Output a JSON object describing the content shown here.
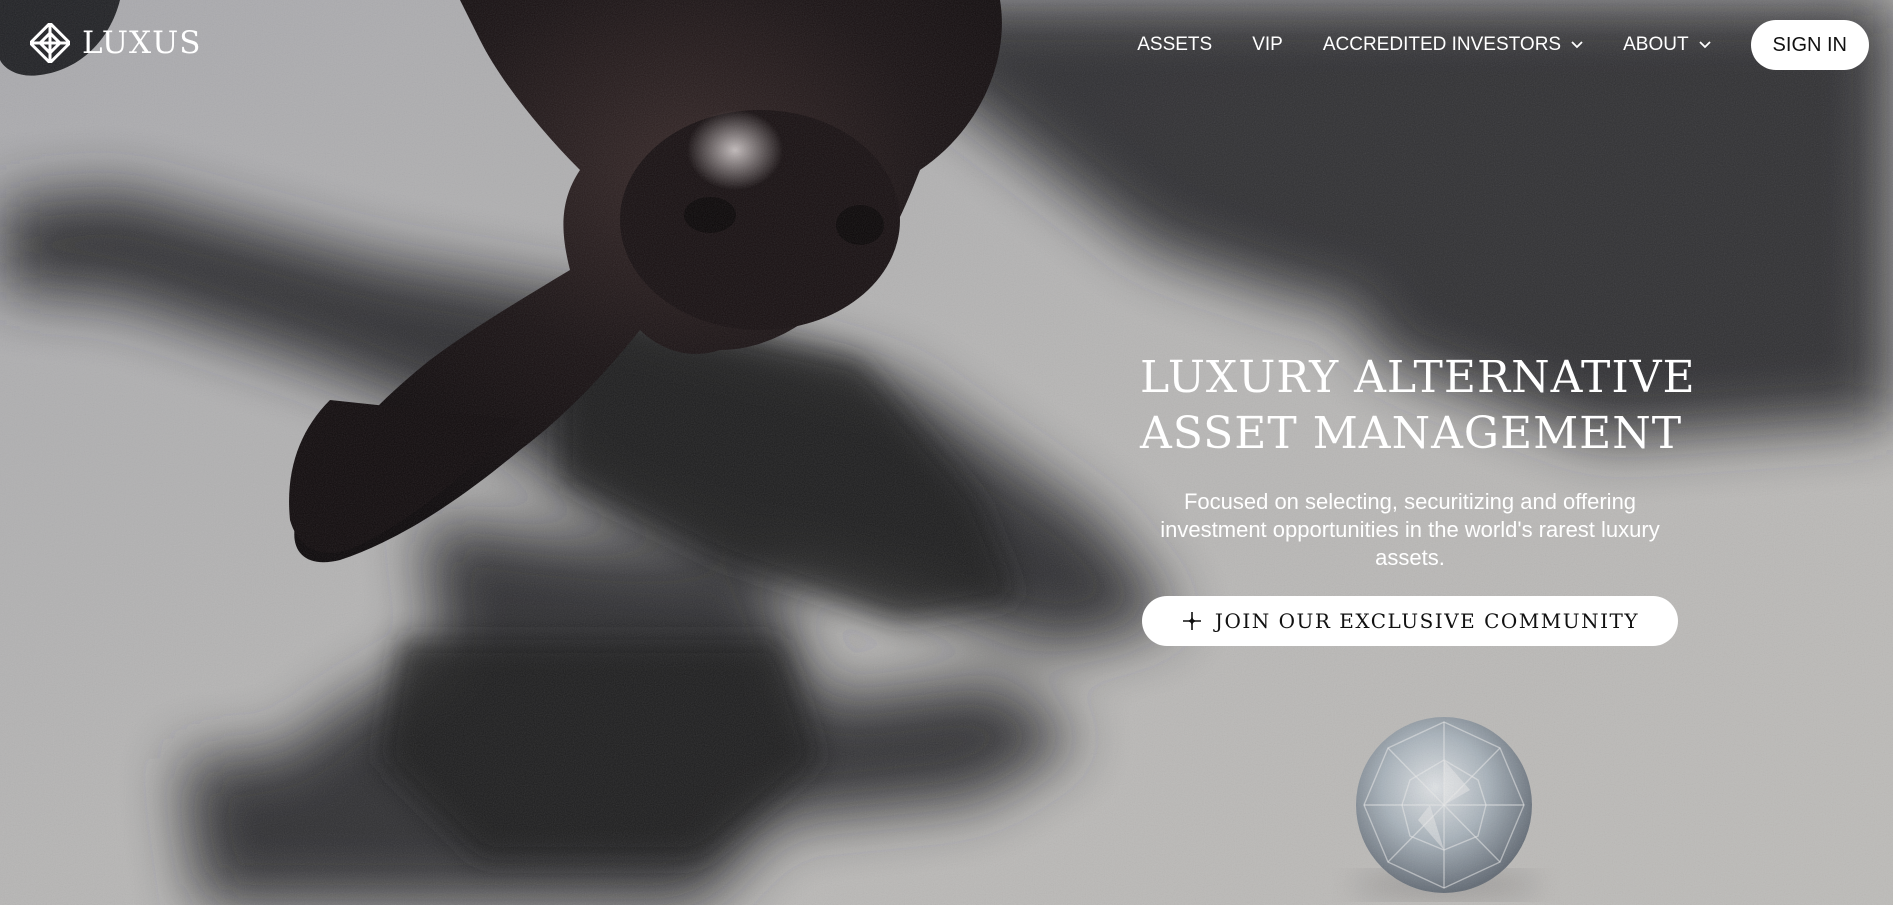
{
  "brand": {
    "name": "LUXUS",
    "logo_icon": "luxus-knot-icon"
  },
  "nav": {
    "items": [
      {
        "label": "ASSETS",
        "has_dropdown": false
      },
      {
        "label": "VIP",
        "has_dropdown": false
      },
      {
        "label": "ACCREDITED INVESTORS",
        "has_dropdown": true
      },
      {
        "label": "ABOUT",
        "has_dropdown": true
      }
    ],
    "sign_in": "SIGN IN"
  },
  "hero": {
    "title_line1": "LUXURY ALTERNATIVE",
    "title_line2": "ASSET MANAGEMENT",
    "subtitle": "Focused on selecting, securitizing and offering investment opportunities in the world's rarest luxury assets.",
    "cta_label": "JOIN OUR EXCLUSIVE COMMUNITY",
    "cta_icon": "sparkle-icon"
  },
  "colors": {
    "text": "#ffffff",
    "button_bg": "#ffffff",
    "button_text": "#111111"
  }
}
